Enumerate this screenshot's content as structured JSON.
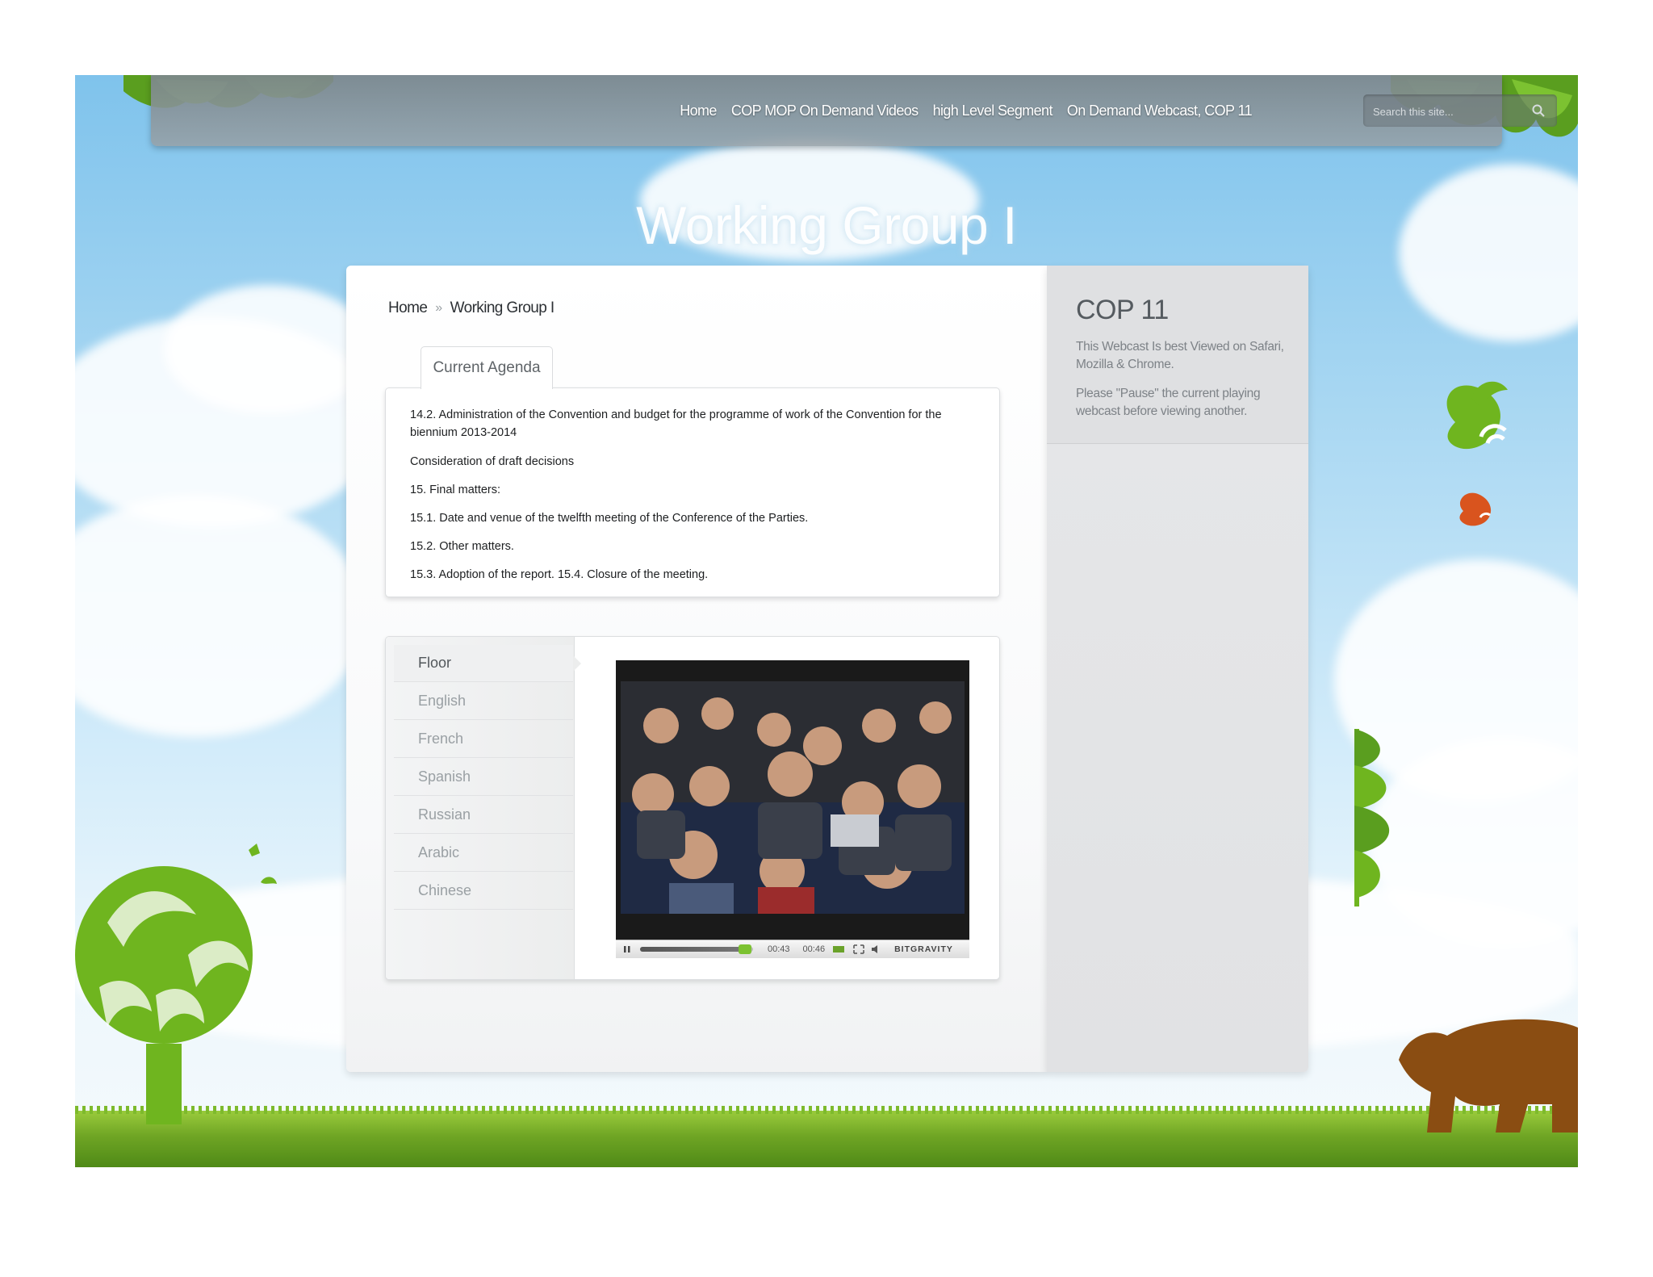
{
  "nav": {
    "items": [
      "Home",
      "COP MOP On Demand Videos",
      "high Level Segment",
      "On Demand Webcast, COP 11"
    ],
    "search_placeholder": "Search this site..."
  },
  "page_title": "Working Group I",
  "breadcrumb": {
    "home": "Home",
    "separator": "»",
    "current": "Working Group I"
  },
  "tab_label": "Current Agenda",
  "agenda_items": [
    "14.2. Administration of the Convention and budget for the programme of work of the Convention for the biennium 2013-2014",
    "Consideration of draft decisions",
    "15. Final matters:",
    "15.1. Date and venue of the twelfth meeting of the Conference of the Parties.",
    "15.2. Other matters.",
    "15.3. Adoption of the report. 15.4. Closure of the meeting."
  ],
  "languages": [
    "Floor",
    "English",
    "French",
    "Spanish",
    "Russian",
    "Arabic",
    "Chinese"
  ],
  "active_language": "Floor",
  "player": {
    "elapsed": "00:43",
    "duration": "00:46",
    "brand": "BITGRAVITY",
    "progress": 0.93,
    "state": "playing",
    "icons": [
      "pause-icon",
      "fullscreen-icon",
      "volume-icon"
    ]
  },
  "sidebar": {
    "title": "COP 11",
    "note1": "This Webcast Is best Viewed on Safari, Mozilla & Chrome.",
    "note2": "Please \"Pause\" the current playing webcast before viewing another."
  },
  "colors": {
    "leaf_green": "#6fb51f",
    "bear_brown": "#8a4d12",
    "bee_orange": "#d9541e",
    "sky_blue": "#7fc3ec"
  }
}
